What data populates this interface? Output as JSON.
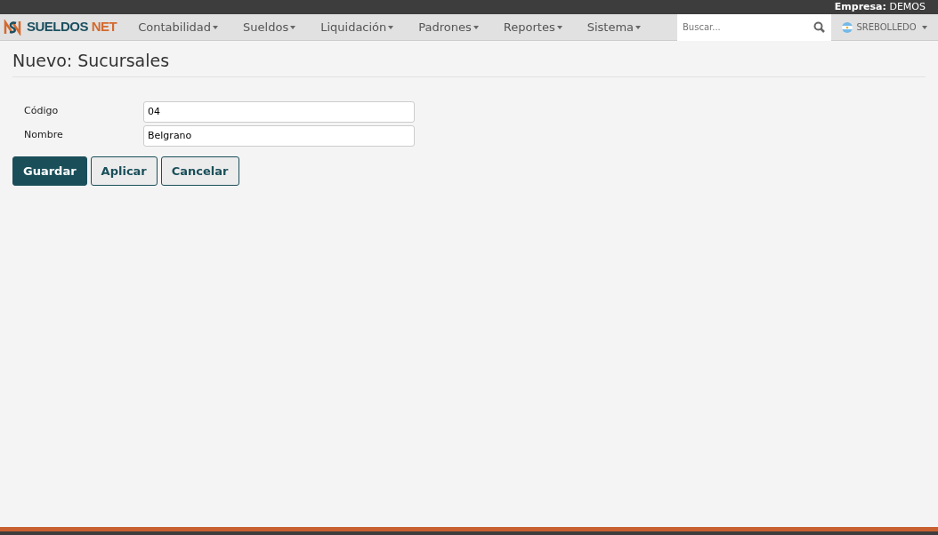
{
  "top_bar": {
    "label": "Empresa:",
    "value": "DEMOS"
  },
  "logo": {
    "primary": "SUELDOS",
    "accent": "NET"
  },
  "menu": [
    {
      "label": "Contabilidad"
    },
    {
      "label": "Sueldos"
    },
    {
      "label": "Liquidación"
    },
    {
      "label": "Padrones"
    },
    {
      "label": "Reportes"
    },
    {
      "label": "Sistema"
    }
  ],
  "search": {
    "placeholder": "Buscar..."
  },
  "user": {
    "name": "SREBOLLEDO"
  },
  "page_title": "Nuevo: Sucursales",
  "fields": [
    {
      "label": "Código",
      "value": "04"
    },
    {
      "label": "Nombre",
      "value": "Belgrano"
    }
  ],
  "buttons": [
    {
      "label": "Guardar",
      "kind": "primary"
    },
    {
      "label": "Aplicar",
      "kind": "secondary"
    },
    {
      "label": "Cancelar",
      "kind": "secondary"
    }
  ]
}
